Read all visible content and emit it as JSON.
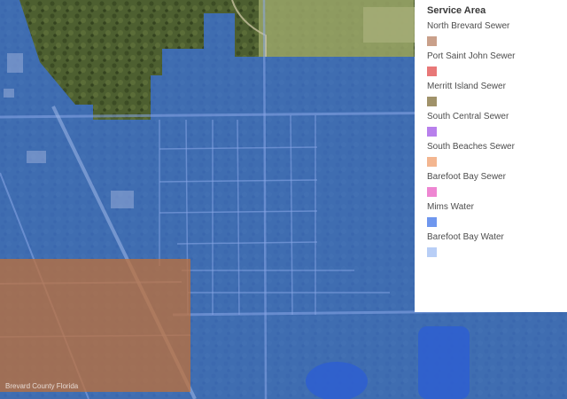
{
  "legend": {
    "title": "Service Area",
    "items": [
      {
        "label": "North Brevard Sewer",
        "color": "#c9a08a"
      },
      {
        "label": "Port Saint John Sewer",
        "color": "#e87878"
      },
      {
        "label": "Merritt Island Sewer",
        "color": "#a0926a"
      },
      {
        "label": "South Central Sewer",
        "color": "#b880ec"
      },
      {
        "label": "South Beaches Sewer",
        "color": "#f3b690"
      },
      {
        "label": "Barefoot Bay Sewer",
        "color": "#ee86d2"
      },
      {
        "label": "Mims Water",
        "color": "#6f97ee"
      },
      {
        "label": "Barefoot Bay Water",
        "color": "#b8cef6"
      }
    ]
  },
  "map": {
    "attribution": "Brevard County Florida",
    "colors": {
      "water_overlay": "#3c70d2",
      "sewer_overlay": "#c07038",
      "vegetation": "#4a5d2c",
      "field": "#9aa668",
      "pond": "#2f5fcf"
    }
  }
}
